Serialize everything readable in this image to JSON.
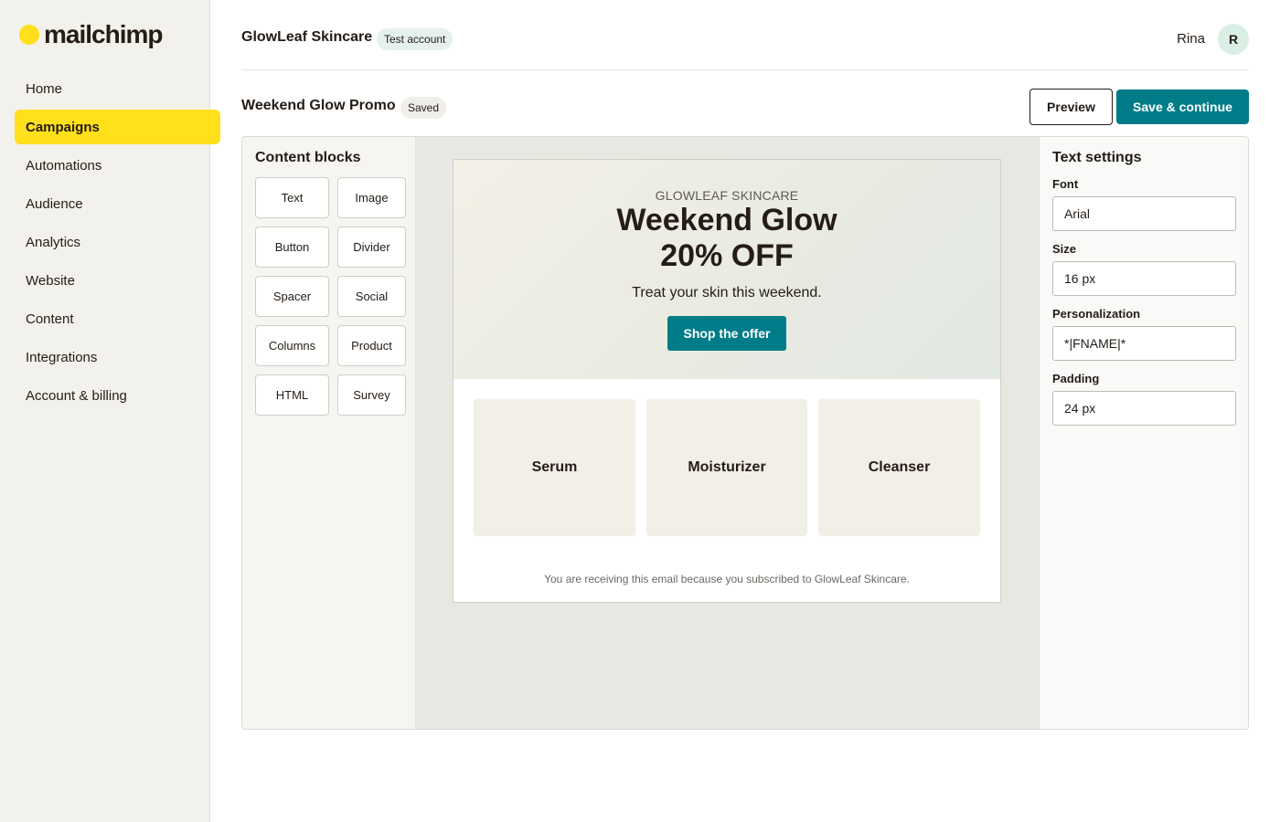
{
  "brand": {
    "logo_text": "mailchimp",
    "accent": "#ffe01b",
    "primary": "#007c89"
  },
  "sidebar": {
    "items": [
      {
        "label": "Home"
      },
      {
        "label": "Campaigns",
        "active": true
      },
      {
        "label": "Automations"
      },
      {
        "label": "Audience"
      },
      {
        "label": "Analytics"
      },
      {
        "label": "Website"
      },
      {
        "label": "Content"
      },
      {
        "label": "Integrations"
      },
      {
        "label": "Account & billing"
      }
    ]
  },
  "header": {
    "org_name": "GlowLeaf Skincare",
    "org_badge": "Test account",
    "user_name": "Rina",
    "avatar_initial": "R"
  },
  "campaign": {
    "title": "Weekend Glow Promo",
    "status": "Saved",
    "preview_label": "Preview",
    "save_label": "Save & continue"
  },
  "blocks_panel": {
    "title": "Content blocks",
    "blocks": [
      "Text",
      "Image",
      "Button",
      "Divider",
      "Spacer",
      "Social",
      "Columns",
      "Product",
      "HTML",
      "Survey"
    ]
  },
  "email": {
    "brand": "GLOWLEAF SKINCARE",
    "headline_line1": "Weekend Glow",
    "headline_line2": "20% OFF",
    "subtext": "Treat your skin this weekend.",
    "cta": "Shop the offer",
    "products": [
      "Serum",
      "Moisturizer",
      "Cleanser"
    ],
    "footer": "You are receiving this email because you subscribed to GlowLeaf Skincare."
  },
  "settings_panel": {
    "title": "Text settings",
    "font_label": "Font",
    "font_value": "Arial",
    "size_label": "Size",
    "size_value": "16 px",
    "personalization_label": "Personalization",
    "personalization_value": "*|FNAME|*",
    "padding_label": "Padding",
    "padding_value": "24 px"
  }
}
